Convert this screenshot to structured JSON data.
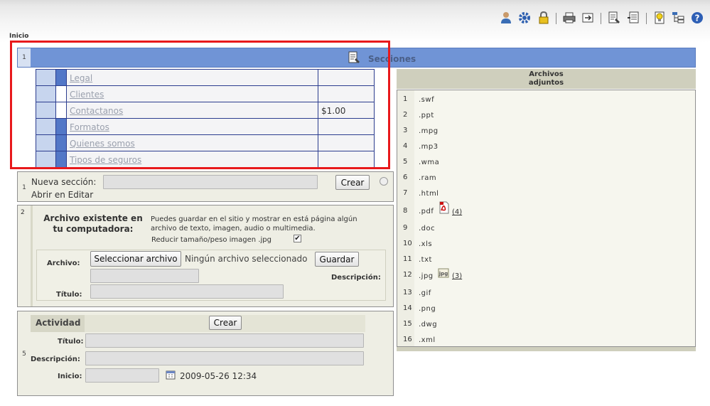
{
  "breadcrumb": "Inicio",
  "toolbar": {
    "icons": [
      "user-icon",
      "gear-icon",
      "lock-icon",
      "printer-icon",
      "export-icon",
      "edit-page-icon",
      "notes-icon",
      "lightbulb-icon",
      "sitemap-icon",
      "help-icon"
    ]
  },
  "sections": {
    "number": "1",
    "title": "Secciones",
    "rows": [
      {
        "name": "Legal",
        "price": ""
      },
      {
        "name": "Clientes",
        "price": ""
      },
      {
        "name": "Contactanos",
        "price": "$1.00"
      },
      {
        "name": "Formatos",
        "price": ""
      },
      {
        "name": "Quienes somos",
        "price": ""
      },
      {
        "name": "Tipos de seguros",
        "price": ""
      }
    ]
  },
  "new_section": {
    "number": "1",
    "label": "Nueva sección:",
    "value": "",
    "create_label": "Crear",
    "open_in_edit": "Abrir en Editar"
  },
  "file_upload": {
    "number": "2",
    "heading_line1": "Archivo existente en",
    "heading_line2": "tu computadora:",
    "desc_line1": "Puedes guardar en el sitio y mostrar en está página algún",
    "desc_line2": "archivo de texto, imagen, audio o multimedia.",
    "reduce_label": "Reducir tamaño/peso imagen .jpg",
    "reduce_checked": true,
    "file_label": "Archivo:",
    "select_button": "Seleccionar archivo",
    "no_file": "Ningún archivo seleccionado",
    "save_button": "Guardar",
    "description_label": "Descripción:",
    "title_label": "Título:"
  },
  "activity": {
    "number": "5",
    "heading": "Actividad",
    "create_label": "Crear",
    "title_label": "Título:",
    "description_label": "Descripción:",
    "start_label": "Inicio:",
    "start_value": "2009-05-26 12:34"
  },
  "attachments": {
    "header_line1": "Archivos",
    "header_line2": "adjuntos",
    "items": [
      {
        "num": "1",
        "ext": ".swf"
      },
      {
        "num": "2",
        "ext": ".ppt"
      },
      {
        "num": "3",
        "ext": ".mpg"
      },
      {
        "num": "4",
        "ext": ".mp3"
      },
      {
        "num": "5",
        "ext": ".wma"
      },
      {
        "num": "6",
        "ext": ".ram"
      },
      {
        "num": "7",
        "ext": ".html"
      },
      {
        "num": "8",
        "ext": ".pdf",
        "icon": "pdf-icon",
        "count": "(4)"
      },
      {
        "num": "9",
        "ext": ".doc"
      },
      {
        "num": "10",
        "ext": ".xls"
      },
      {
        "num": "11",
        "ext": ".txt"
      },
      {
        "num": "12",
        "ext": ".jpg",
        "icon": "jpg-icon",
        "count": "(3)"
      },
      {
        "num": "13",
        "ext": ".gif"
      },
      {
        "num": "14",
        "ext": ".png"
      },
      {
        "num": "15",
        "ext": ".dwg"
      },
      {
        "num": "16",
        "ext": ".xml"
      }
    ]
  }
}
